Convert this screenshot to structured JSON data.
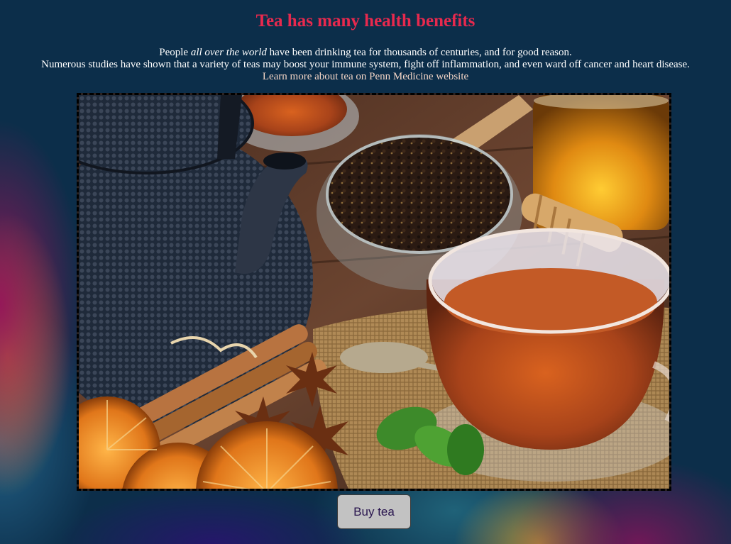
{
  "page": {
    "heading": "Tea has many health benefits",
    "intro": {
      "line1_before": "People ",
      "line1_emphasis": "all over the world",
      "line1_after": " have been drinking tea for thousands of centuries, and for good reason.",
      "line2": "Numerous studies have shown that a variety of teas may boost your immune system, fight off inflammation, and even ward off cancer and heart disease.",
      "link_text": "Learn more about tea on Penn Medicine website"
    },
    "hero_image": {
      "depicts": [
        "cast-iron-teapot",
        "loose-leaf-tea-bowl",
        "cup-of-tea",
        "cinnamon-sticks",
        "star-anise",
        "dried-orange-slices",
        "mint-leaves",
        "honey-jar"
      ]
    },
    "button": {
      "label": "Buy tea"
    }
  },
  "colors": {
    "background": "#0c2e4a",
    "heading": "#e8294e",
    "text": "#ffffff",
    "link": "#f3d5c6",
    "button_bg": "#c2c2c2",
    "button_text": "#2a164f",
    "image_border": "#000000"
  }
}
